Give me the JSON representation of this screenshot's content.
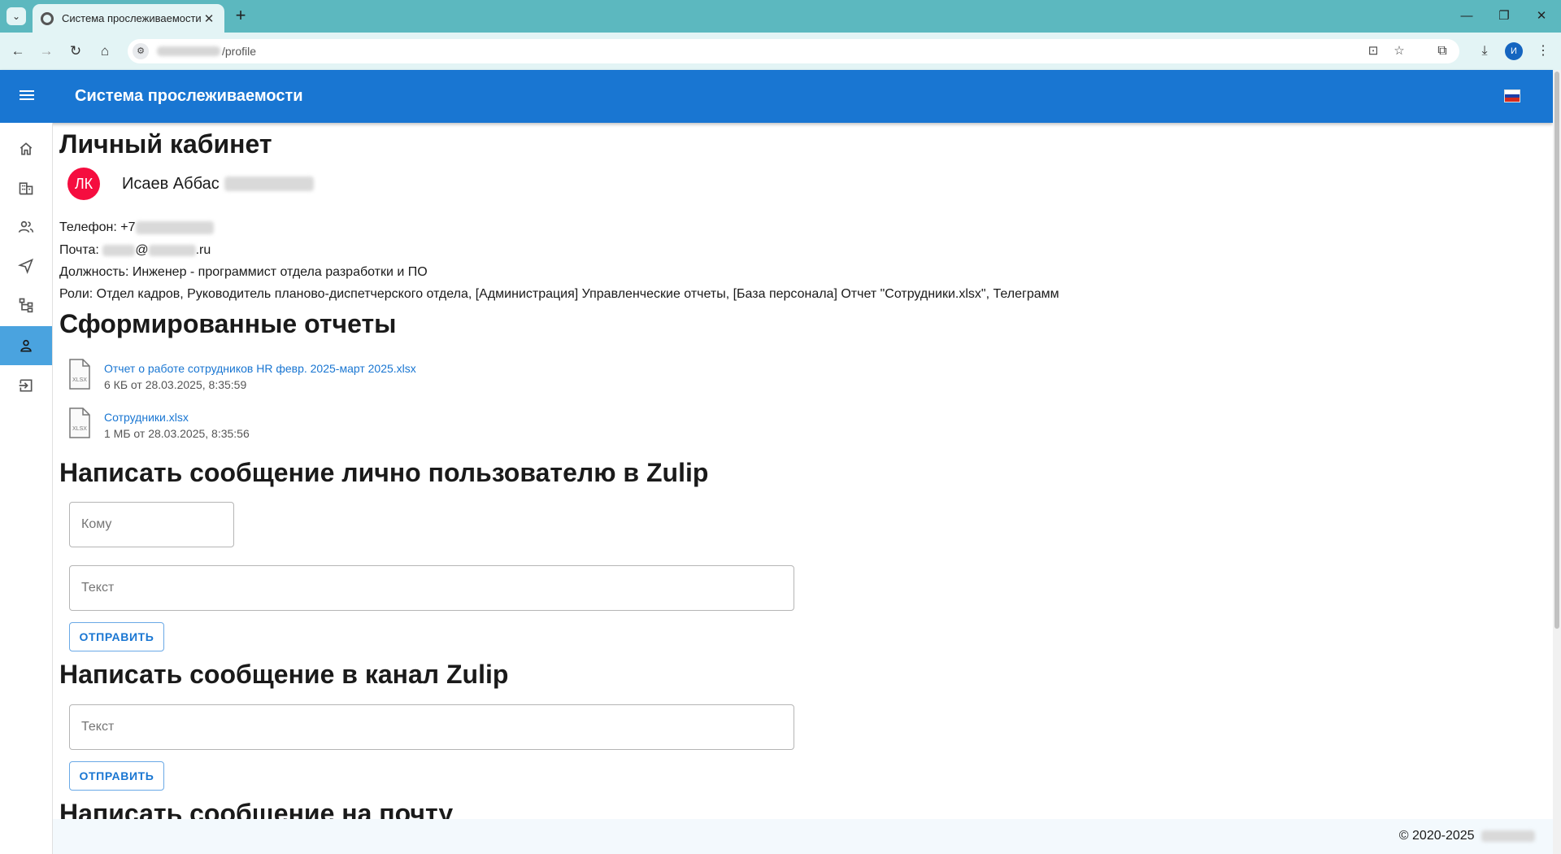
{
  "browser": {
    "tab_title": "Система прослеживаемости",
    "url_path": "/profile",
    "profile_initial": "И"
  },
  "header": {
    "title": "Система прослеживаемости"
  },
  "colors": {
    "app_bar": "#1976d2",
    "avatar": "#f50d3f",
    "browser_frame": "#5cb8bf",
    "active_nav": "#4aa3df"
  },
  "sidebar": {
    "items": [
      {
        "icon": "home-icon"
      },
      {
        "icon": "building-icon"
      },
      {
        "icon": "people-icon"
      },
      {
        "icon": "send-icon"
      },
      {
        "icon": "hierarchy-icon"
      },
      {
        "icon": "person-icon",
        "active": true
      },
      {
        "icon": "logout-icon"
      }
    ]
  },
  "profile": {
    "page_title": "Личный кабинет",
    "avatar_text": "ЛК",
    "user_name": "Исаев Аббас",
    "phone_label": "Телефон: +7",
    "email_label": "Почта:",
    "email_at": "@",
    "email_tld": ".ru",
    "position": "Должность: Инженер - программист отдела разработки и ПО",
    "roles": "Роли: Отдел кадров, Руководитель планово-диспетчерского отдела, [Администрация] Управленческие отчеты, [База персонала] Отчет \"Сотрудники.xlsx\", Телеграмм"
  },
  "reports": {
    "title": "Сформированные отчеты",
    "files": [
      {
        "name": "Отчет о работе сотрудников HR февр. 2025-март 2025.xlsx",
        "meta": "6 КБ от 28.03.2025, 8:35:59",
        "ext": "XLSX"
      },
      {
        "name": "Сотрудники.xlsx",
        "meta": "1 МБ от 28.03.2025, 8:35:56",
        "ext": "XLSX"
      }
    ]
  },
  "zulip_direct": {
    "title": "Написать сообщение лично пользователю в Zulip",
    "to_placeholder": "Кому",
    "text_placeholder": "Текст",
    "send_label": "ОТПРАВИТЬ"
  },
  "zulip_channel": {
    "title": "Написать сообщение в канал Zulip",
    "text_placeholder": "Текст",
    "send_label": "ОТПРАВИТЬ"
  },
  "email": {
    "title": "Написать сообщение на почту"
  },
  "footer": {
    "copyright": "© 2020-2025"
  }
}
